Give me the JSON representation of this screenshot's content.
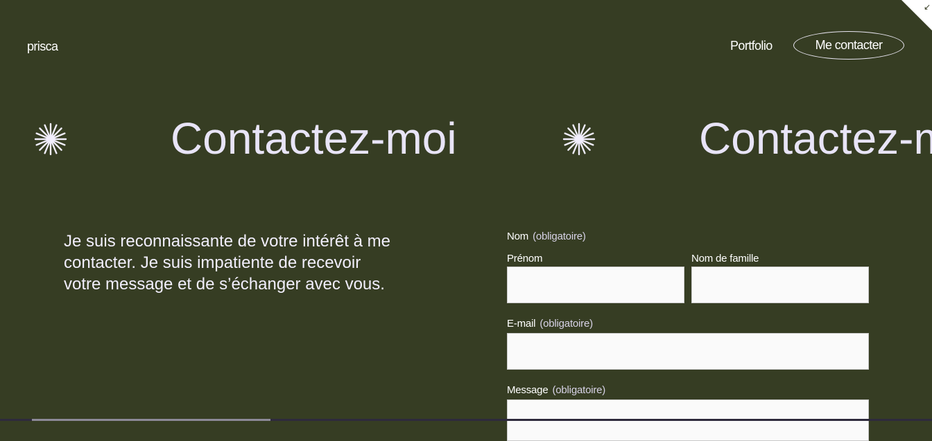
{
  "header": {
    "brand": "prisca",
    "nav": {
      "portfolio": "Portfolio",
      "contact": "Me contacter"
    }
  },
  "hero": {
    "title": "Contactez-moi",
    "icon": "starburst-icon"
  },
  "intro": {
    "text": "Je suis reconnaissante de votre intérêt à me contacter. Je suis impatiente de recevoir votre message et de s’échanger avec vous."
  },
  "form": {
    "name_label": "Nom",
    "required_tag": "(obligatoire)",
    "first_name_label": "Prénom",
    "last_name_label": "Nom de famille",
    "email_label": "E-mail",
    "message_label": "Message",
    "first_name_value": "",
    "last_name_value": "",
    "email_value": "",
    "message_value": ""
  },
  "colors": {
    "background": "#363d23",
    "heading": "#e8e4f7",
    "field": "#fafafa"
  }
}
